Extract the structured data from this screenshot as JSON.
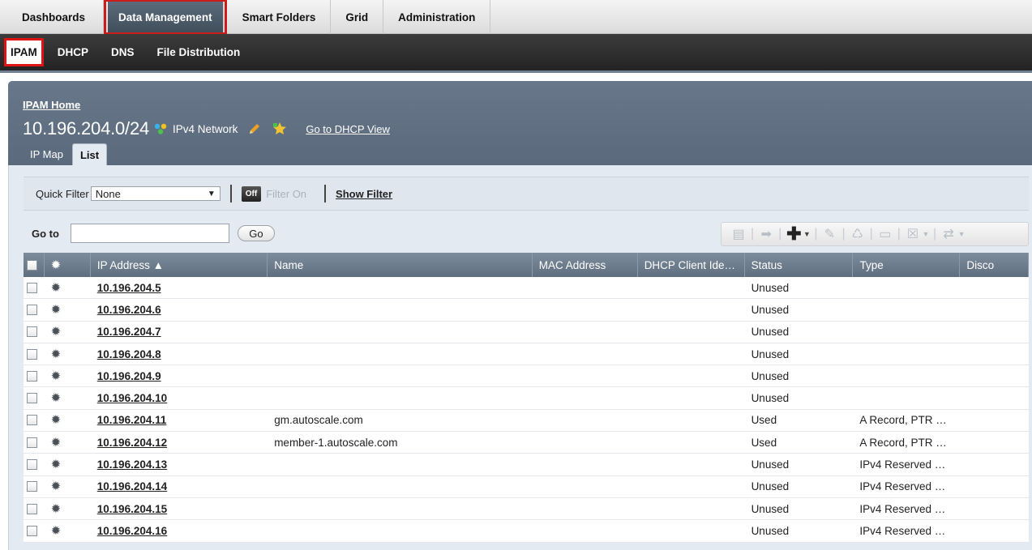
{
  "topnav": {
    "tabs": [
      "Dashboards",
      "Data Management",
      "Smart Folders",
      "Grid",
      "Administration"
    ],
    "active": 1
  },
  "subnav": {
    "tabs": [
      "IPAM",
      "DHCP",
      "DNS",
      "File Distribution"
    ],
    "active": 0
  },
  "header": {
    "home_link": "IPAM Home",
    "network": "10.196.204.0/24",
    "network_type": "IPv4 Network",
    "dhcp_link": "Go to DHCP View"
  },
  "view_tabs": {
    "ip_map": "IP Map",
    "list": "List"
  },
  "filter": {
    "quick_filter_label": "Quick Filter",
    "quick_filter_value": "None",
    "toggle_off": "Off",
    "filter_on": "Filter On",
    "show_filter": "Show Filter"
  },
  "goto": {
    "label": "Go to",
    "value": "",
    "button": "Go"
  },
  "table": {
    "columns": [
      "IP Address ▲",
      "Name",
      "MAC Address",
      "DHCP Client Ide…",
      "Status",
      "Type",
      "Disco"
    ],
    "rows": [
      {
        "ip": "10.196.204.5",
        "name": "",
        "status": "Unused",
        "type": ""
      },
      {
        "ip": "10.196.204.6",
        "name": "",
        "status": "Unused",
        "type": ""
      },
      {
        "ip": "10.196.204.7",
        "name": "",
        "status": "Unused",
        "type": ""
      },
      {
        "ip": "10.196.204.8",
        "name": "",
        "status": "Unused",
        "type": ""
      },
      {
        "ip": "10.196.204.9",
        "name": "",
        "status": "Unused",
        "type": ""
      },
      {
        "ip": "10.196.204.10",
        "name": "",
        "status": "Unused",
        "type": ""
      },
      {
        "ip": "10.196.204.11",
        "name": "gm.autoscale.com",
        "status": "Used",
        "type": "A Record, PTR …"
      },
      {
        "ip": "10.196.204.12",
        "name": "member-1.autoscale.com",
        "status": "Used",
        "type": "A Record, PTR …"
      },
      {
        "ip": "10.196.204.13",
        "name": "",
        "status": "Unused",
        "type": "IPv4 Reserved …"
      },
      {
        "ip": "10.196.204.14",
        "name": "",
        "status": "Unused",
        "type": "IPv4 Reserved …"
      },
      {
        "ip": "10.196.204.15",
        "name": "",
        "status": "Unused",
        "type": "IPv4 Reserved …"
      },
      {
        "ip": "10.196.204.16",
        "name": "",
        "status": "Unused",
        "type": "IPv4 Reserved …"
      }
    ]
  }
}
